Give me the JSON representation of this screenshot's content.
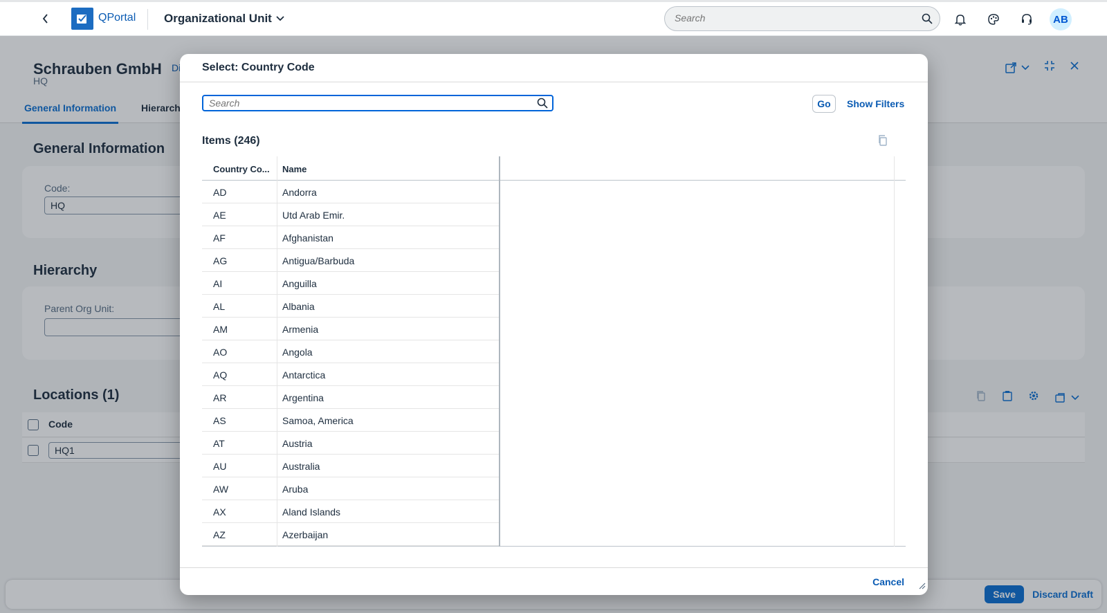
{
  "shell": {
    "logo_text": "QPortal",
    "app_title": "Organizational Unit",
    "search_placeholder": "Search",
    "avatar_initials": "AB",
    "accent_color": "#0a6ed1"
  },
  "object_page": {
    "title": "Schrauben GmbH",
    "subtitle": "HQ",
    "draft_link": "Di",
    "tabs": [
      {
        "label": "General Information",
        "active": true
      },
      {
        "label": "Hierarchy",
        "active": false
      }
    ],
    "general_section": {
      "title": "General Information",
      "code_label": "Code:",
      "code_value": "HQ"
    },
    "hierarchy_section": {
      "title": "Hierarchy",
      "parent_label": "Parent Org Unit:",
      "parent_value": ""
    },
    "locations_section": {
      "title": "Locations (1)",
      "column_code": "Code",
      "rows": [
        {
          "code": "HQ1"
        }
      ]
    },
    "footer": {
      "save_label": "Save",
      "discard_label": "Discard Draft"
    }
  },
  "dialog": {
    "title": "Select: Country Code",
    "search_placeholder": "Search",
    "go_label": "Go",
    "show_filters_label": "Show Filters",
    "items_title": "Items (246)",
    "columns": {
      "code": "Country Co...",
      "name": "Name"
    },
    "rows": [
      {
        "code": "AD",
        "name": "Andorra"
      },
      {
        "code": "AE",
        "name": "Utd Arab Emir."
      },
      {
        "code": "AF",
        "name": "Afghanistan"
      },
      {
        "code": "AG",
        "name": "Antigua/Barbuda"
      },
      {
        "code": "AI",
        "name": "Anguilla"
      },
      {
        "code": "AL",
        "name": "Albania"
      },
      {
        "code": "AM",
        "name": "Armenia"
      },
      {
        "code": "AO",
        "name": "Angola"
      },
      {
        "code": "AQ",
        "name": "Antarctica"
      },
      {
        "code": "AR",
        "name": "Argentina"
      },
      {
        "code": "AS",
        "name": "Samoa, America"
      },
      {
        "code": "AT",
        "name": "Austria"
      },
      {
        "code": "AU",
        "name": "Australia"
      },
      {
        "code": "AW",
        "name": "Aruba"
      },
      {
        "code": "AX",
        "name": "Aland Islands"
      },
      {
        "code": "AZ",
        "name": "Azerbaijan"
      }
    ],
    "cancel_label": "Cancel"
  }
}
